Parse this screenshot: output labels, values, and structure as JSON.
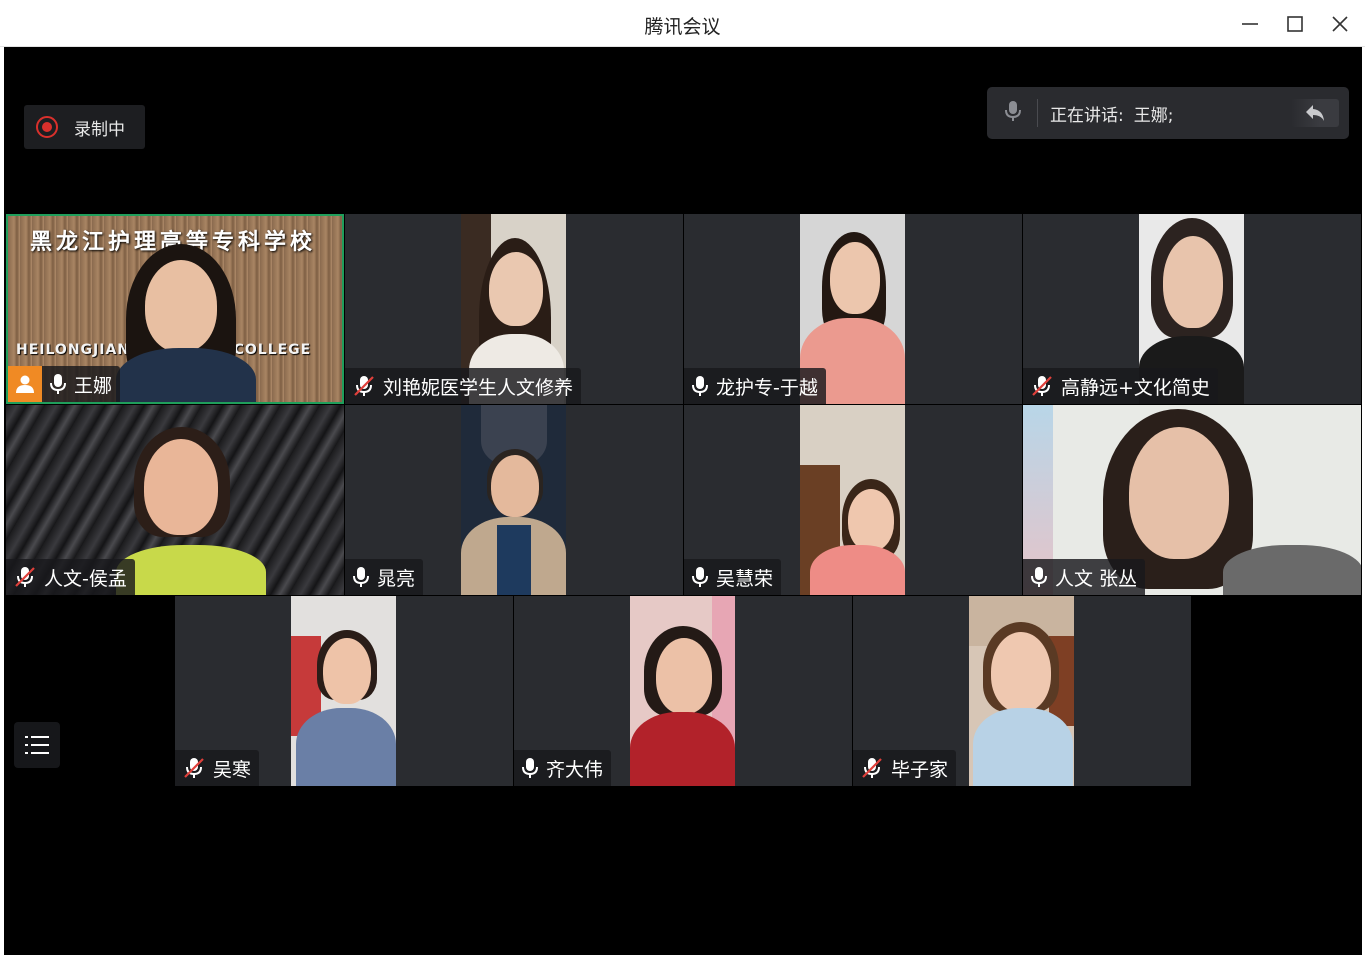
{
  "window": {
    "title": "腾讯会议"
  },
  "recording": {
    "label": "录制中",
    "color": "#d9302c"
  },
  "speaking": {
    "label": "正在讲话:",
    "names": "王娜;"
  },
  "participants": [
    {
      "name": "王娜",
      "muted": false,
      "host": true,
      "active": true,
      "bg_text": "黑龙江护理高等专科学校",
      "bg_en": "HEILONGJIANG NURSING COLLEGE"
    },
    {
      "name": "刘艳妮医学生人文修养",
      "muted": true
    },
    {
      "name": "龙护专-于越",
      "muted": false
    },
    {
      "name": "高静远+文化简史",
      "muted": true
    },
    {
      "name": "人文-侯孟",
      "muted": true
    },
    {
      "name": "晁亮",
      "muted": false
    },
    {
      "name": "吴慧荣",
      "muted": false
    },
    {
      "name": "人文 张丛",
      "muted": false
    },
    {
      "name": "吴寒",
      "muted": true
    },
    {
      "name": "齐大伟",
      "muted": false
    },
    {
      "name": "毕子家",
      "muted": true
    }
  ],
  "icons": {
    "minimize": "minimize-icon",
    "maximize": "maximize-icon",
    "close": "close-icon",
    "mic": "microphone-icon",
    "mic_muted": "microphone-muted-icon",
    "host": "host-icon",
    "list": "participant-list-icon",
    "return": "return-icon"
  },
  "colors": {
    "active_border": "#1f9e5b",
    "host_badge": "#f08a24",
    "tile_bg": "#2a2c30"
  }
}
